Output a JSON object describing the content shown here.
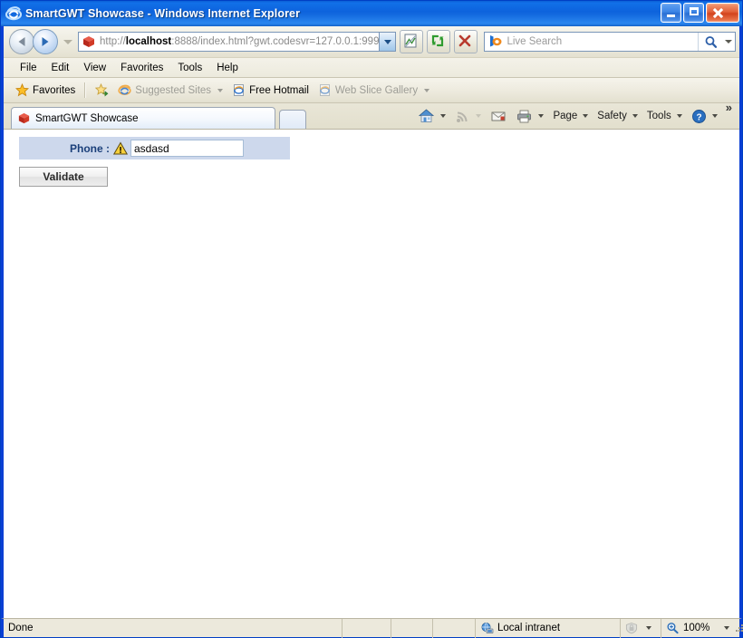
{
  "window": {
    "title": "SmartGWT Showcase - Windows Internet Explorer",
    "icon": "ie-logo-icon",
    "minimize_label": "Minimize",
    "maximize_label": "Maximize",
    "close_label": "Close"
  },
  "nav": {
    "back_label": "Back",
    "forward_label": "Forward",
    "recent_pages_label": "Recent Pages",
    "compatibility_label": "Compatibility View",
    "refresh_label": "Refresh",
    "stop_label": "Stop"
  },
  "address": {
    "scheme": "http://",
    "host": "localhost",
    "rest": ":8888/index.html?gwt.codesvr=127.0.0.1:999",
    "full_url": "http://localhost:8888/index.html?gwt.codesvr=127.0.0.1:999",
    "favicon": "smartgwt-cube-icon"
  },
  "search": {
    "placeholder": "Live Search",
    "value": "",
    "provider_icon": "bing-logo-icon",
    "go_label": "Search"
  },
  "menu": {
    "items": [
      {
        "label": "File"
      },
      {
        "label": "Edit"
      },
      {
        "label": "View"
      },
      {
        "label": "Favorites"
      },
      {
        "label": "Tools"
      },
      {
        "label": "Help"
      }
    ]
  },
  "favorites_bar": {
    "favorites_label": "Favorites",
    "add_label": "Add to Favorites Bar",
    "items": [
      {
        "label": "Suggested Sites",
        "icon": "ie-page-icon",
        "dimmed": true,
        "caret": true
      },
      {
        "label": "Free Hotmail",
        "icon": "ie-page-icon",
        "dimmed": false,
        "caret": false
      },
      {
        "label": "Web Slice Gallery",
        "icon": "ie-page-icon",
        "dimmed": true,
        "caret": true
      }
    ]
  },
  "tabs": {
    "items": [
      {
        "label": "SmartGWT Showcase",
        "icon": "smartgwt-cube-icon",
        "active": true
      }
    ],
    "new_tab_label": "New Tab"
  },
  "command_bar": {
    "items": [
      {
        "label": "",
        "icon": "home-icon",
        "caret": true,
        "dimmed": false
      },
      {
        "label": "",
        "icon": "feeds-icon",
        "caret": true,
        "dimmed": true
      },
      {
        "label": "",
        "icon": "mail-icon",
        "caret": false,
        "dimmed": false
      },
      {
        "label": "",
        "icon": "print-icon",
        "caret": true,
        "dimmed": false
      },
      {
        "label": "Page",
        "icon": "",
        "caret": true,
        "dimmed": false
      },
      {
        "label": "Safety",
        "icon": "",
        "caret": true,
        "dimmed": false
      },
      {
        "label": "Tools",
        "icon": "",
        "caret": true,
        "dimmed": false
      },
      {
        "label": "",
        "icon": "help-icon",
        "caret": true,
        "dimmed": false
      }
    ],
    "overflow_label": "»"
  },
  "page": {
    "form": {
      "label": "Phone :",
      "validation_icon": "warning-triangle-icon",
      "input_value": "asdasd",
      "input_placeholder": "",
      "button_label": "Validate"
    }
  },
  "status_bar": {
    "status_text": "Done",
    "zone_text": "Local intranet",
    "zone_icon": "intranet-globe-icon",
    "protected_icon": "protected-mode-icon",
    "zoom_icon": "zoom-magnifier-icon",
    "zoom_level": "100%"
  },
  "colors": {
    "title_blue": "#0d63dd",
    "chrome": "#eceadd",
    "form_panel": "#cdd8ec",
    "label_blue": "#1a3f7a",
    "warning_yellow": "#f5c518",
    "close_red": "#d2431d"
  }
}
